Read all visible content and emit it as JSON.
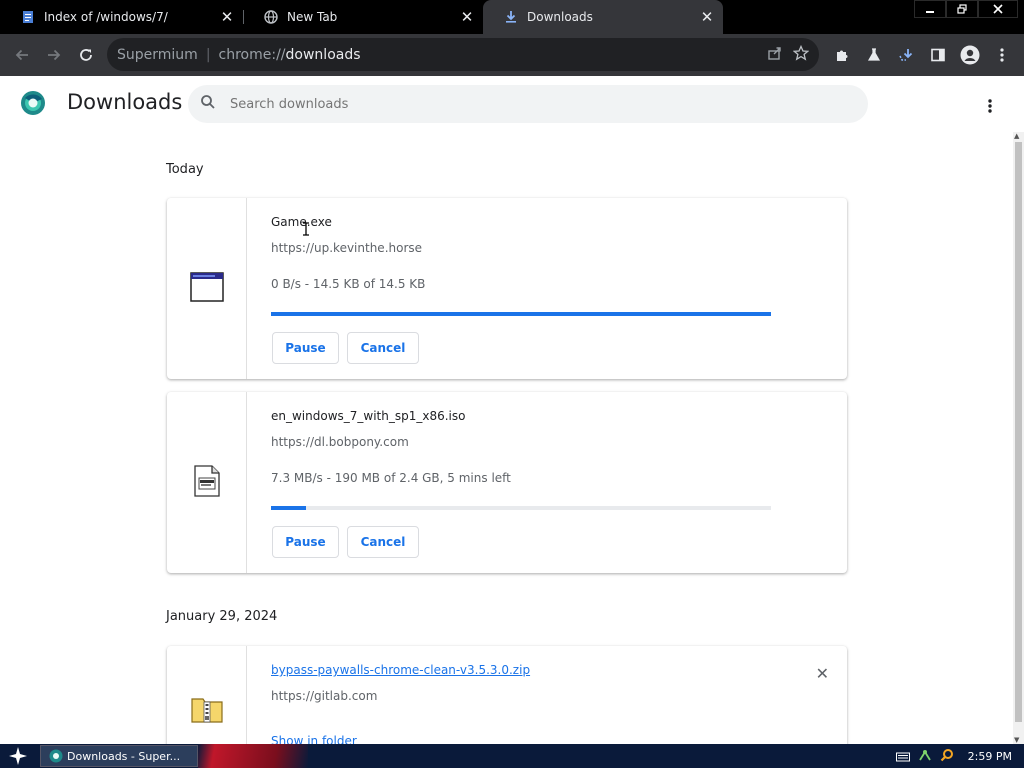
{
  "tabs": [
    {
      "title": "Index of /windows/7/",
      "icon": "document-icon"
    },
    {
      "title": "New Tab",
      "icon": "globe-icon"
    },
    {
      "title": "Downloads",
      "icon": "download-icon",
      "active": true
    }
  ],
  "omnibox": {
    "scheme": "Supermium",
    "url_prefix": "chrome://",
    "url_path": "downloads"
  },
  "header": {
    "title": "Downloads",
    "search_placeholder": "Search downloads"
  },
  "groups": [
    {
      "date": "Today",
      "items": [
        {
          "name": "Game.exe",
          "url": "https://up.kevinthe.horse",
          "status": "0 B/s - 14.5 KB of 14.5 KB",
          "progress_percent": 100,
          "pause_label": "Pause",
          "cancel_label": "Cancel",
          "icon": "window-app-icon"
        },
        {
          "name": "en_windows_7_with_sp1_x86.iso",
          "url": "https://dl.bobpony.com",
          "status": "7.3 MB/s - 190 MB of 2.4 GB, 5 mins left",
          "progress_percent": 7,
          "pause_label": "Pause",
          "cancel_label": "Cancel",
          "icon": "disc-image-icon"
        }
      ]
    },
    {
      "date": "January 29, 2024",
      "items": [
        {
          "name": "bypass-paywalls-chrome-clean-v3.5.3.0.zip",
          "url": "https://gitlab.com",
          "show_in_folder_label": "Show in folder",
          "icon": "zip-folder-icon"
        }
      ]
    }
  ],
  "taskbar": {
    "task_label": "Downloads - Super...",
    "clock": "2:59 PM"
  },
  "colors": {
    "accent": "#1a73e8",
    "titlebar": "#000000",
    "toolbar": "#35363a",
    "taskbar": "#0a1a3a"
  }
}
